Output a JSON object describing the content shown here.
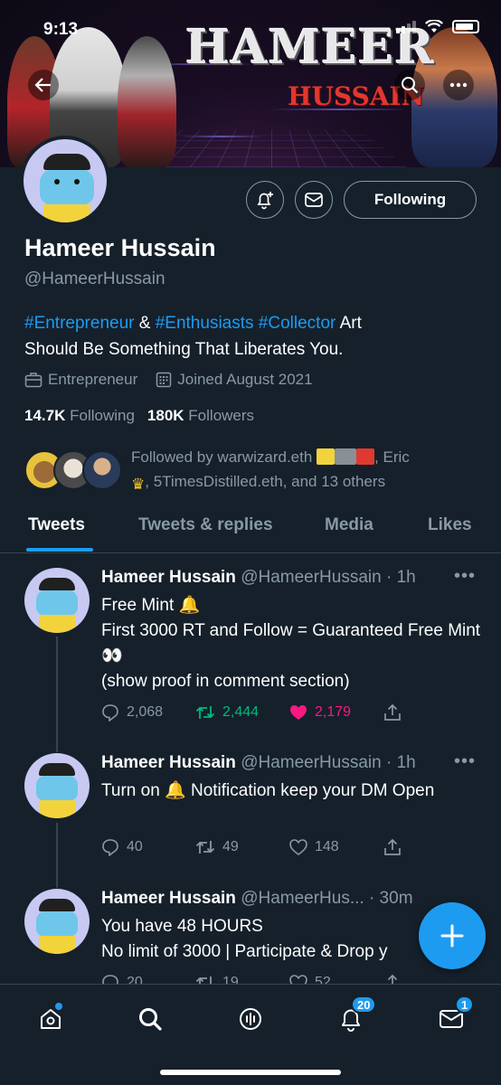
{
  "status_bar": {
    "time": "9:13"
  },
  "banner": {
    "title": "HAMEER",
    "subtitle": "HUSSAIN"
  },
  "profile": {
    "name": "Hameer Hussain",
    "handle": "@HameerHussain",
    "bio_tags": [
      "#Entrepreneur",
      "&",
      "#Enthusiasts",
      "#Collector"
    ],
    "bio_rest_1": "Art",
    "bio_rest_2": "Should Be Something That Liberates You.",
    "category": "Entrepreneur",
    "joined": "Joined August 2021",
    "following_count": "14.7K",
    "following_label": "Following",
    "followers_count": "180K",
    "followers_label": "Followers",
    "follow_button": "Following",
    "followed_by_1": "Followed by warwizard.eth",
    "followed_by_2": ", Eric",
    "followed_by_3": ", 5TimesDistilled.eth, and 13 others"
  },
  "tabs": [
    "Tweets",
    "Tweets & replies",
    "Media",
    "Likes"
  ],
  "tweets": [
    {
      "name": "Hameer Hussain",
      "meta": "@HameerHussain · 1h",
      "body": "Free Mint 🔔\nFirst 3000 RT and Follow  = Guaranteed Free Mint 👀\n(show proof in comment section)",
      "replies": "2,068",
      "retweets": "2,444",
      "likes": "2,179"
    },
    {
      "name": "Hameer Hussain",
      "meta": "@HameerHussain · 1h",
      "body": "Turn on 🔔 Notification keep your DM Open",
      "replies": "40",
      "retweets": "49",
      "likes": "148"
    },
    {
      "name": "Hameer Hussain",
      "meta": "@HameerHus... · 30m",
      "body": "You have 48 HOURS\nNo limit of 3000 | Participate & Drop y",
      "replies": "20",
      "retweets": "19",
      "likes": "52"
    }
  ],
  "nav": {
    "notifications_badge": "20",
    "messages_badge": "1"
  },
  "colors": {
    "background": "#15202b",
    "accent": "#1d9bf0",
    "muted": "#8899a6",
    "retweet": "#00ba7c",
    "like": "#f91880"
  }
}
